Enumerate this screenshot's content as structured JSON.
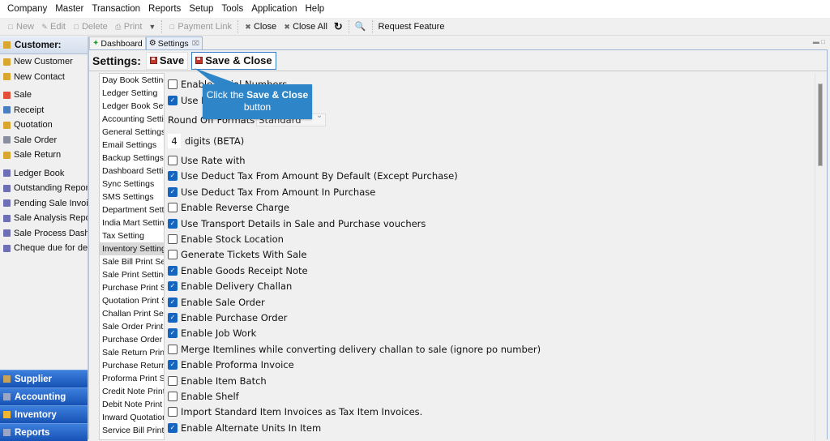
{
  "menu": [
    "Company",
    "Master",
    "Transaction",
    "Reports",
    "Setup",
    "Tools",
    "Application",
    "Help"
  ],
  "toolbar": {
    "new": "New",
    "edit": "Edit",
    "delete": "Delete",
    "print": "Print",
    "payment_link": "Payment Link",
    "close": "Close",
    "close_all": "Close All",
    "request_feature": "Request Feature"
  },
  "sidebar": {
    "header": "Customer:",
    "items": [
      {
        "label": "New Customer",
        "icon": "customer-icon",
        "color": "#d9a62e"
      },
      {
        "label": "New Contact",
        "icon": "contact-icon",
        "color": "#d9a62e"
      },
      {
        "label": "Sale",
        "icon": "sale-icon",
        "color": "#e2503a",
        "gap": true
      },
      {
        "label": "Receipt",
        "icon": "receipt-icon",
        "color": "#4a7fc1"
      },
      {
        "label": "Quotation",
        "icon": "quotation-icon",
        "color": "#d9a62e"
      },
      {
        "label": "Sale Order",
        "icon": "sale-order-icon",
        "color": "#8a8fa0"
      },
      {
        "label": "Sale Return",
        "icon": "sale-return-icon",
        "color": "#d9a62e"
      },
      {
        "label": "Ledger Book",
        "icon": "report-icon",
        "color": "#6f6fb5",
        "gap": true
      },
      {
        "label": "Outstanding Report",
        "icon": "report-icon",
        "color": "#6f6fb5"
      },
      {
        "label": "Pending Sale Invoices",
        "icon": "report-icon",
        "color": "#6f6fb5"
      },
      {
        "label": "Sale Analysis Report",
        "icon": "report-icon",
        "color": "#6f6fb5"
      },
      {
        "label": "Sale Process Dashboard",
        "icon": "report-icon",
        "color": "#6f6fb5"
      },
      {
        "label": "Cheque due for deposit",
        "icon": "report-icon",
        "color": "#6f6fb5"
      }
    ],
    "categories": [
      {
        "label": "Supplier",
        "icon": "supplier-icon",
        "color": "#c9a25a"
      },
      {
        "label": "Accounting",
        "icon": "accounting-icon",
        "color": "#9aa6c8"
      },
      {
        "label": "Inventory",
        "icon": "inventory-icon",
        "color": "#f2b632"
      },
      {
        "label": "Reports",
        "icon": "reports-icon",
        "color": "#9aa6c8"
      }
    ]
  },
  "tabs": [
    {
      "label": "Dashboard",
      "active": false
    },
    {
      "label": "Settings",
      "active": true,
      "closable": true
    }
  ],
  "settings": {
    "title": "Settings:",
    "save": "Save",
    "save_close": "Save & Close",
    "list": [
      "Day Book Setting",
      "Ledger Setting",
      "Ledger Book Setting",
      "Accounting Setting",
      "General Settings",
      "Email Settings",
      "Backup Settings",
      "Dashboard Setting",
      "Sync Settings",
      "SMS Settings",
      "Department Setting",
      "India Mart Setting",
      "Tax Setting",
      "Inventory Setting",
      "Sale Bill Print Setting",
      "Sale Print Setting",
      "Purchase Print Setting",
      "Quotation Print Setting",
      "Challan Print Setting",
      "Sale Order Print Setting",
      "Purchase Order Print Setting",
      "Sale Return Print Setting",
      "Purchase Return Print Setting",
      "Proforma Print Setting",
      "Credit Note Print Setting",
      "Debit Note Print Setting",
      "Inward Quotation",
      "Service Bill Print Setting"
    ],
    "selected": "Inventory Setting",
    "round_off_label": "Round Off Formats",
    "round_off_value": "Standard",
    "digits_value": "4",
    "digits_label": "digits (BETA)",
    "options_top": [
      {
        "label": "Enable Serial Numbers",
        "checked": false
      },
      {
        "label": "Use Rate ...",
        "checked": true
      }
    ],
    "options": [
      {
        "label": "Use Rate with",
        "checked": false
      },
      {
        "label": "Use Deduct Tax From Amount By Default (Except Purchase)",
        "checked": true
      },
      {
        "label": "Use Deduct Tax From Amount In Purchase",
        "checked": true
      },
      {
        "label": "Enable Reverse Charge",
        "checked": false
      },
      {
        "label": "Use Transport Details in Sale and Purchase vouchers",
        "checked": true
      },
      {
        "label": "Enable Stock Location",
        "checked": false
      },
      {
        "label": "Generate Tickets With Sale",
        "checked": false
      },
      {
        "label": "Enable Goods Receipt Note",
        "checked": true
      },
      {
        "label": "Enable Delivery Challan",
        "checked": true
      },
      {
        "label": "Enable Sale Order",
        "checked": true
      },
      {
        "label": "Enable Purchase Order",
        "checked": true
      },
      {
        "label": "Enable Job Work",
        "checked": true
      },
      {
        "label": "Merge Itemlines while converting delivery challan to sale (ignore po number)",
        "checked": false
      },
      {
        "label": "Enable Proforma Invoice",
        "checked": true
      },
      {
        "label": "Enable Item Batch",
        "checked": false
      },
      {
        "label": "Enable Shelf",
        "checked": false
      },
      {
        "label": "Import Standard Item Invoices as Tax Item Invoices.",
        "checked": false
      },
      {
        "label": "Enable Alternate Units In Item",
        "checked": true
      }
    ],
    "scroll_position": 0,
    "scroll_visible_fraction": 0.23
  },
  "callout": {
    "prefix": "Click the ",
    "bold": "Save & Close",
    "suffix": "button",
    "color": "#2e86c9"
  }
}
